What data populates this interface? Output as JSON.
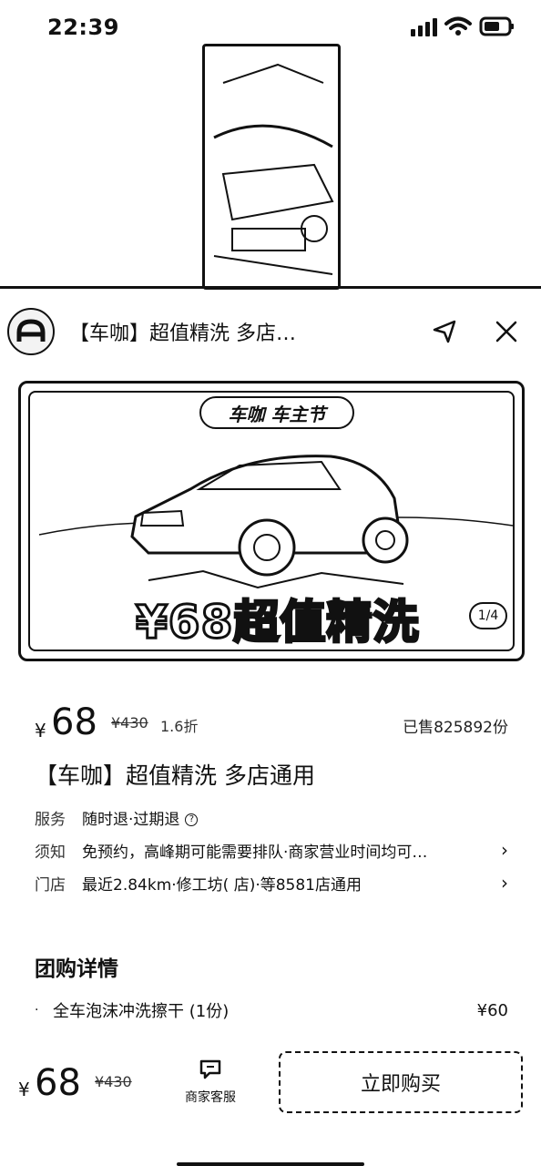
{
  "status_bar": {
    "time": "22:39",
    "battery_icon": "battery-icon",
    "wifi_icon": "wifi-icon",
    "signal_icon": "signal-icon"
  },
  "header": {
    "title": "【车咖】超值精洗  多店…",
    "logo_icon": "brand-logo-icon",
    "share_icon": "share-icon",
    "close_icon": "close-icon"
  },
  "banner": {
    "brand_text": "车咖 车主节",
    "price_text": "¥68超值精洗",
    "counter": "1/4"
  },
  "price": {
    "currency": "¥",
    "current": "68",
    "original": "¥430",
    "discount": "1.6折",
    "sold": "已售825892份"
  },
  "deal_title": "【车咖】超值精洗 多店通用",
  "info": {
    "service_key": "服务",
    "service_val": "随时退·过期退",
    "notice_key": "须知",
    "notice_val": "免预约，高峰期可能需要排队·商家营业时间均可…",
    "store_key": "门店",
    "store_val": "最近2.84km·修工坊(                店)·等8581店通用"
  },
  "detail": {
    "section_title": "团购详情",
    "items": [
      {
        "name": "全车泡沫冲洗擦干 (1份)",
        "price": "¥60"
      }
    ]
  },
  "bottom": {
    "currency": "¥",
    "price": "68",
    "original": "¥430",
    "service_label": "商家客服",
    "service_icon": "chat-icon",
    "buy_label": "立即购买"
  },
  "colors": {
    "text": "#111111",
    "background": "#ffffff"
  }
}
